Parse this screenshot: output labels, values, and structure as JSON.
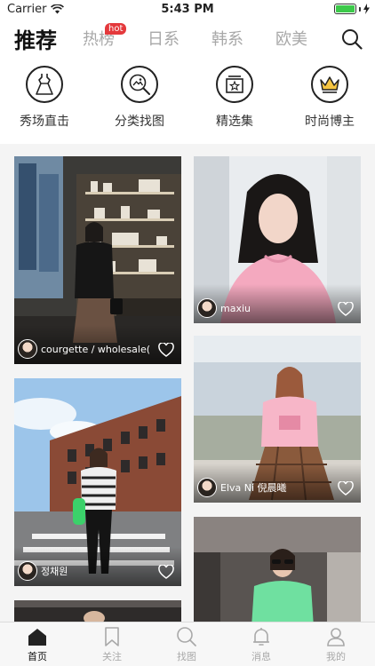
{
  "status": {
    "carrier": "Carrier",
    "time": "5:43 PM"
  },
  "tabs": [
    {
      "label": "推荐",
      "active": true
    },
    {
      "label": "热榜",
      "badge": "hot"
    },
    {
      "label": "日系"
    },
    {
      "label": "韩系"
    },
    {
      "label": "欧美"
    }
  ],
  "categories": [
    {
      "label": "秀场直击",
      "icon": "dress-icon"
    },
    {
      "label": "分类找图",
      "icon": "image-search-icon"
    },
    {
      "label": "精选集",
      "icon": "star-box-icon"
    },
    {
      "label": "时尚博主",
      "icon": "crown-icon"
    }
  ],
  "feed": [
    {
      "author": "courgette / wholesale(…"
    },
    {
      "author": "maxiu"
    },
    {
      "author": "Elva Ni 倪晨曦"
    },
    {
      "author": "정채원"
    }
  ],
  "bottom_tabs": [
    {
      "label": "首页",
      "active": true,
      "icon": "home-icon"
    },
    {
      "label": "关注",
      "icon": "bookmark-icon"
    },
    {
      "label": "找图",
      "icon": "search-icon"
    },
    {
      "label": "消息",
      "icon": "bell-icon"
    },
    {
      "label": "我的",
      "icon": "user-icon"
    }
  ],
  "colors": {
    "hot_badge": "#e4393c",
    "battery": "#3cc94a"
  }
}
